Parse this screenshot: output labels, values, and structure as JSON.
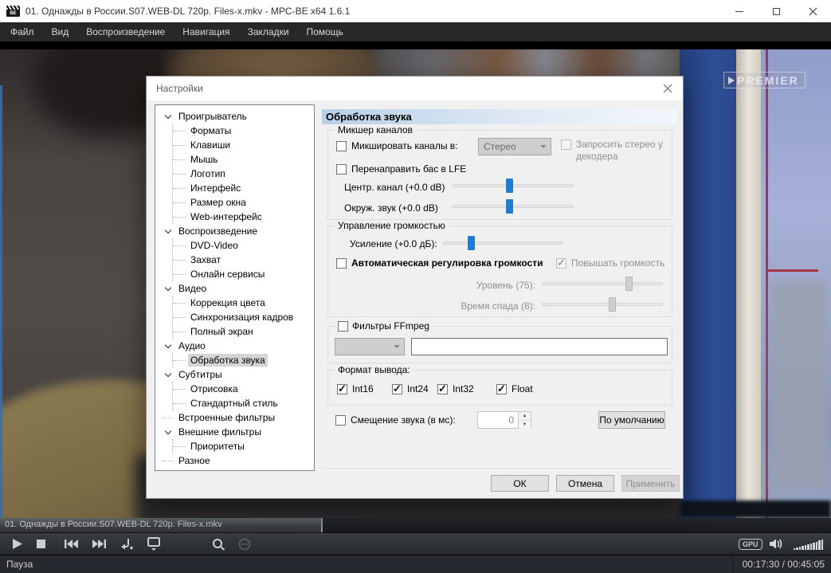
{
  "window": {
    "title": "01. Однажды в России.S07.WEB-DL 720p. Files-x.mkv - MPC-BE x64 1.6.1"
  },
  "menu": {
    "items": [
      "Файл",
      "Вид",
      "Воспроизведение",
      "Навигация",
      "Закладки",
      "Помощь"
    ]
  },
  "video": {
    "watermark": "PREMIER"
  },
  "dialog": {
    "title": "Настройки",
    "header": "Обработка звука",
    "tree": [
      {
        "label": "Проигрыватель"
      },
      {
        "label": "Форматы"
      },
      {
        "label": "Клавиши"
      },
      {
        "label": "Мышь"
      },
      {
        "label": "Логотип"
      },
      {
        "label": "Интерфейс"
      },
      {
        "label": "Размер окна"
      },
      {
        "label": "Web-интерфейс"
      },
      {
        "label": "Воспроизведение"
      },
      {
        "label": "DVD-Video"
      },
      {
        "label": "Захват"
      },
      {
        "label": "Онлайн сервисы"
      },
      {
        "label": "Видео"
      },
      {
        "label": "Коррекция цвета"
      },
      {
        "label": "Синхронизация кадров"
      },
      {
        "label": "Полный экран"
      },
      {
        "label": "Аудио"
      },
      {
        "label": "Обработка звука"
      },
      {
        "label": "Субтитры"
      },
      {
        "label": "Отрисовка"
      },
      {
        "label": "Стандартный стиль"
      },
      {
        "label": "Встроенные фильтры"
      },
      {
        "label": "Внешние фильтры"
      },
      {
        "label": "Приоритеты"
      },
      {
        "label": "Разное"
      }
    ],
    "mixer": {
      "legend": "Микшер каналов",
      "mix_checkbox": "Микшировать каналы в:",
      "mix_select_value": "Стерео",
      "request_stereo": "Запросить стерео у декодера",
      "bass_lfe": "Перенаправить бас в LFE",
      "center_label": "Центр. канал (+0.0 dB)",
      "surround_label": "Окруж. звук (+0.0 dB)"
    },
    "volume": {
      "legend": "Управление громкостью",
      "gain_label": "Усиление (+0.0 дБ):",
      "auto_checkbox": "Автоматическая регулировка громкости",
      "boost_checkbox": "Повышать громкость",
      "level_label": "Уровень (75):",
      "release_label": "Время спада (8):"
    },
    "ffmpeg": {
      "legend": "Фильтры FFmpeg",
      "select_value": "",
      "input_value": ""
    },
    "format": {
      "legend": "Формат вывода:",
      "options": [
        "Int16",
        "Int24",
        "Int32",
        "Float"
      ]
    },
    "offset": {
      "label": "Смещение звука (в мс):",
      "value": "0",
      "default_button": "По умолчанию"
    },
    "buttons": {
      "ok": "ОК",
      "cancel": "Отмена",
      "apply": "Применить"
    }
  },
  "seekbar": {
    "filename": "01. Однажды в России.S07.WEB-DL 720p. Files-x.mkv",
    "progress_percent": 38.8,
    "progress_style": "width:405px"
  },
  "toolbar": {
    "gpu_badge": "GPU"
  },
  "statusbar": {
    "state": "Пауза",
    "time": "00:17:30 / 00:45:05"
  },
  "colors": {
    "accent_blue": "#1a7fd4",
    "selection_gray": "#d4d4d4",
    "header_blue": "#b9cfe8"
  }
}
